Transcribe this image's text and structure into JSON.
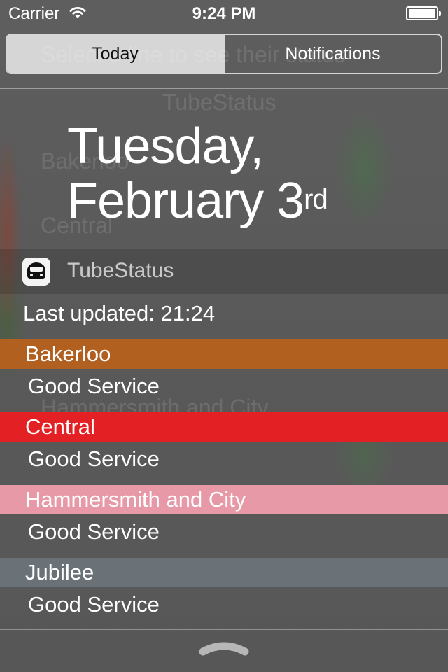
{
  "status_bar": {
    "carrier": "Carrier",
    "time": "9:24 PM"
  },
  "segments": {
    "today": "Today",
    "notifications": "Notifications"
  },
  "date": {
    "weekday": "Tuesday,",
    "month_day": "February 3",
    "ordinal_suffix": "rd"
  },
  "widget": {
    "app_name": "TubeStatus",
    "last_updated": "Last updated: 21:24",
    "lines": [
      {
        "name": "Bakerloo",
        "status": "Good Service",
        "color": "#B26020"
      },
      {
        "name": "Central",
        "status": "Good Service",
        "color": "#E32124"
      },
      {
        "name": "Hammersmith and City",
        "status": "Good Service",
        "color": "#E899A8"
      },
      {
        "name": "Jubilee",
        "status": "Good Service",
        "color": "#6A7278"
      }
    ]
  },
  "icons": {
    "wifi": "wifi-icon",
    "battery": "battery-icon",
    "app": "tube-train-icon",
    "grabber": "pull-up-handle-icon"
  }
}
